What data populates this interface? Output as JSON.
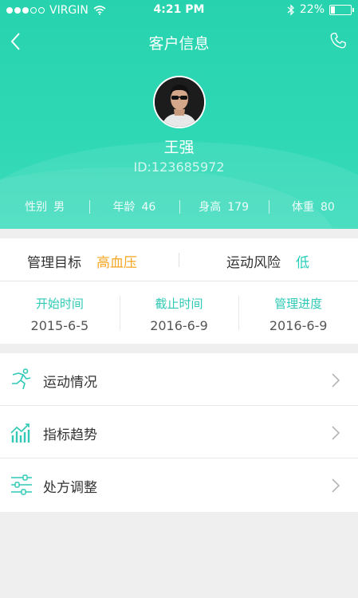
{
  "status_bar": {
    "carrier": "VIRGIN",
    "time": "4:21 PM",
    "battery": "22%",
    "battery_level": 0.22
  },
  "nav": {
    "title": "客户信息"
  },
  "profile": {
    "name": "王强",
    "id": "ID:123685972"
  },
  "stats": [
    {
      "label": "性别",
      "value": "男"
    },
    {
      "label": "年龄",
      "value": "46"
    },
    {
      "label": "身高",
      "value": "179"
    },
    {
      "label": "体重",
      "value": "80"
    }
  ],
  "goal": {
    "label": "管理目标",
    "value": "高血压",
    "risk_label": "运动风险",
    "risk_value": "低"
  },
  "timeline": [
    {
      "label": "开始时间",
      "value": "2015-6-5"
    },
    {
      "label": "截止时间",
      "value": "2016-6-9"
    },
    {
      "label": "管理进度",
      "value": "2016-6-9"
    }
  ],
  "menu": [
    {
      "label": "运动情况",
      "icon": "running-icon"
    },
    {
      "label": "指标趋势",
      "icon": "chart-trend-icon"
    },
    {
      "label": "处方调整",
      "icon": "sliders-icon"
    }
  ],
  "colors": {
    "primary": "#2fd8b5",
    "accent_orange": "#f5a623",
    "accent_teal": "#27cdbb"
  }
}
